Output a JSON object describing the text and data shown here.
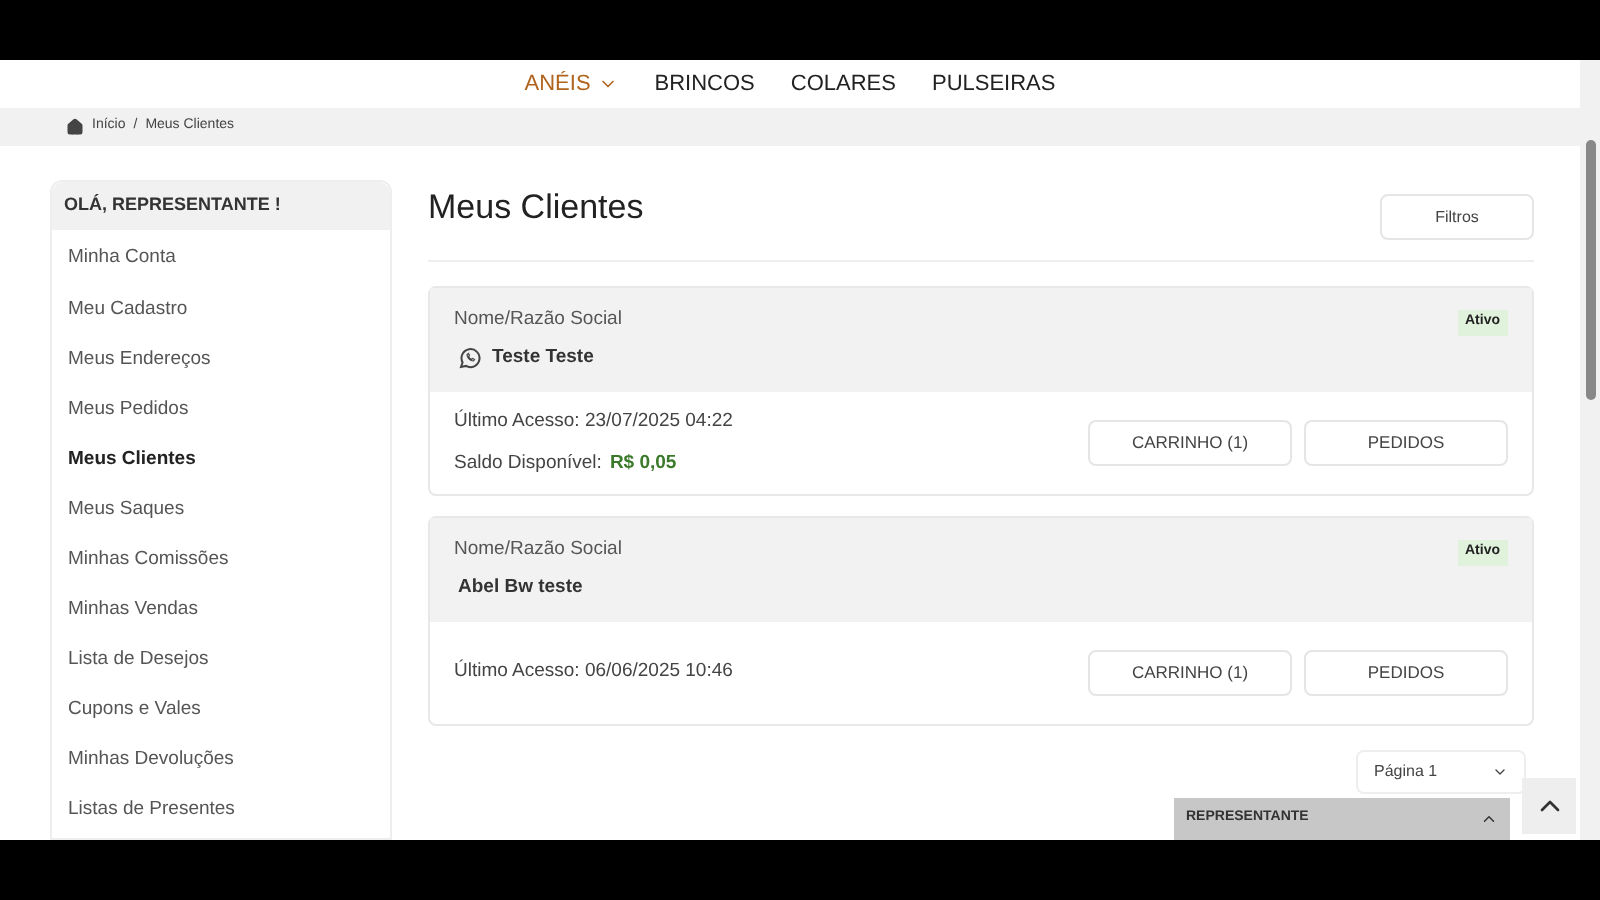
{
  "nav": [
    {
      "label": "ANÉIS",
      "selected": true,
      "dropdown": true
    },
    {
      "label": "BRINCOS",
      "selected": false,
      "dropdown": false
    },
    {
      "label": "COLARES",
      "selected": false,
      "dropdown": false
    },
    {
      "label": "PULSEIRAS",
      "selected": false,
      "dropdown": false
    }
  ],
  "breadcrumb": [
    "Início",
    "Meus Clientes"
  ],
  "breadcrumb_separator": "/",
  "sidebar": {
    "title": "OLÁ, REPRESENTANTE !",
    "items": [
      {
        "label": "Minha Conta",
        "selected": false
      },
      {
        "label": "Meu Cadastro",
        "selected": false
      },
      {
        "label": "Meus Endereços",
        "selected": false
      },
      {
        "label": "Meus Pedidos",
        "selected": false
      },
      {
        "label": "Meus Clientes",
        "selected": true
      },
      {
        "label": "Meus Saques",
        "selected": false
      },
      {
        "label": "Minhas Comissões",
        "selected": false
      },
      {
        "label": "Minhas Vendas",
        "selected": false
      },
      {
        "label": "Lista de Desejos",
        "selected": false
      },
      {
        "label": "Cupons e Vales",
        "selected": false
      },
      {
        "label": "Minhas Devoluções",
        "selected": false
      },
      {
        "label": "Listas de Presentes",
        "selected": false
      }
    ]
  },
  "page_title": "Meus Clientes",
  "filter_button": "Filtros",
  "clients": [
    {
      "name_label": "Nome/Razão Social",
      "name": "Teste Teste",
      "whatsapp": true,
      "status": "Ativo",
      "last_access": "Último Acesso: 23/07/2025 04:22",
      "balance_label": "Saldo Disponível:",
      "balance": "R$ 0,05",
      "cart_button": "CARRINHO (1)",
      "orders_button": "PEDIDOS"
    },
    {
      "name_label": "Nome/Razão Social",
      "name": "Abel Bw teste",
      "whatsapp": false,
      "status": "Ativo",
      "last_access": "Último Acesso: 06/06/2025 10:46",
      "cart_button": "CARRINHO (1)",
      "orders_button": "PEDIDOS"
    }
  ],
  "pagination": "Página 1",
  "floating_panel": {
    "title": "REPRESENTANTE",
    "expanded": false
  }
}
